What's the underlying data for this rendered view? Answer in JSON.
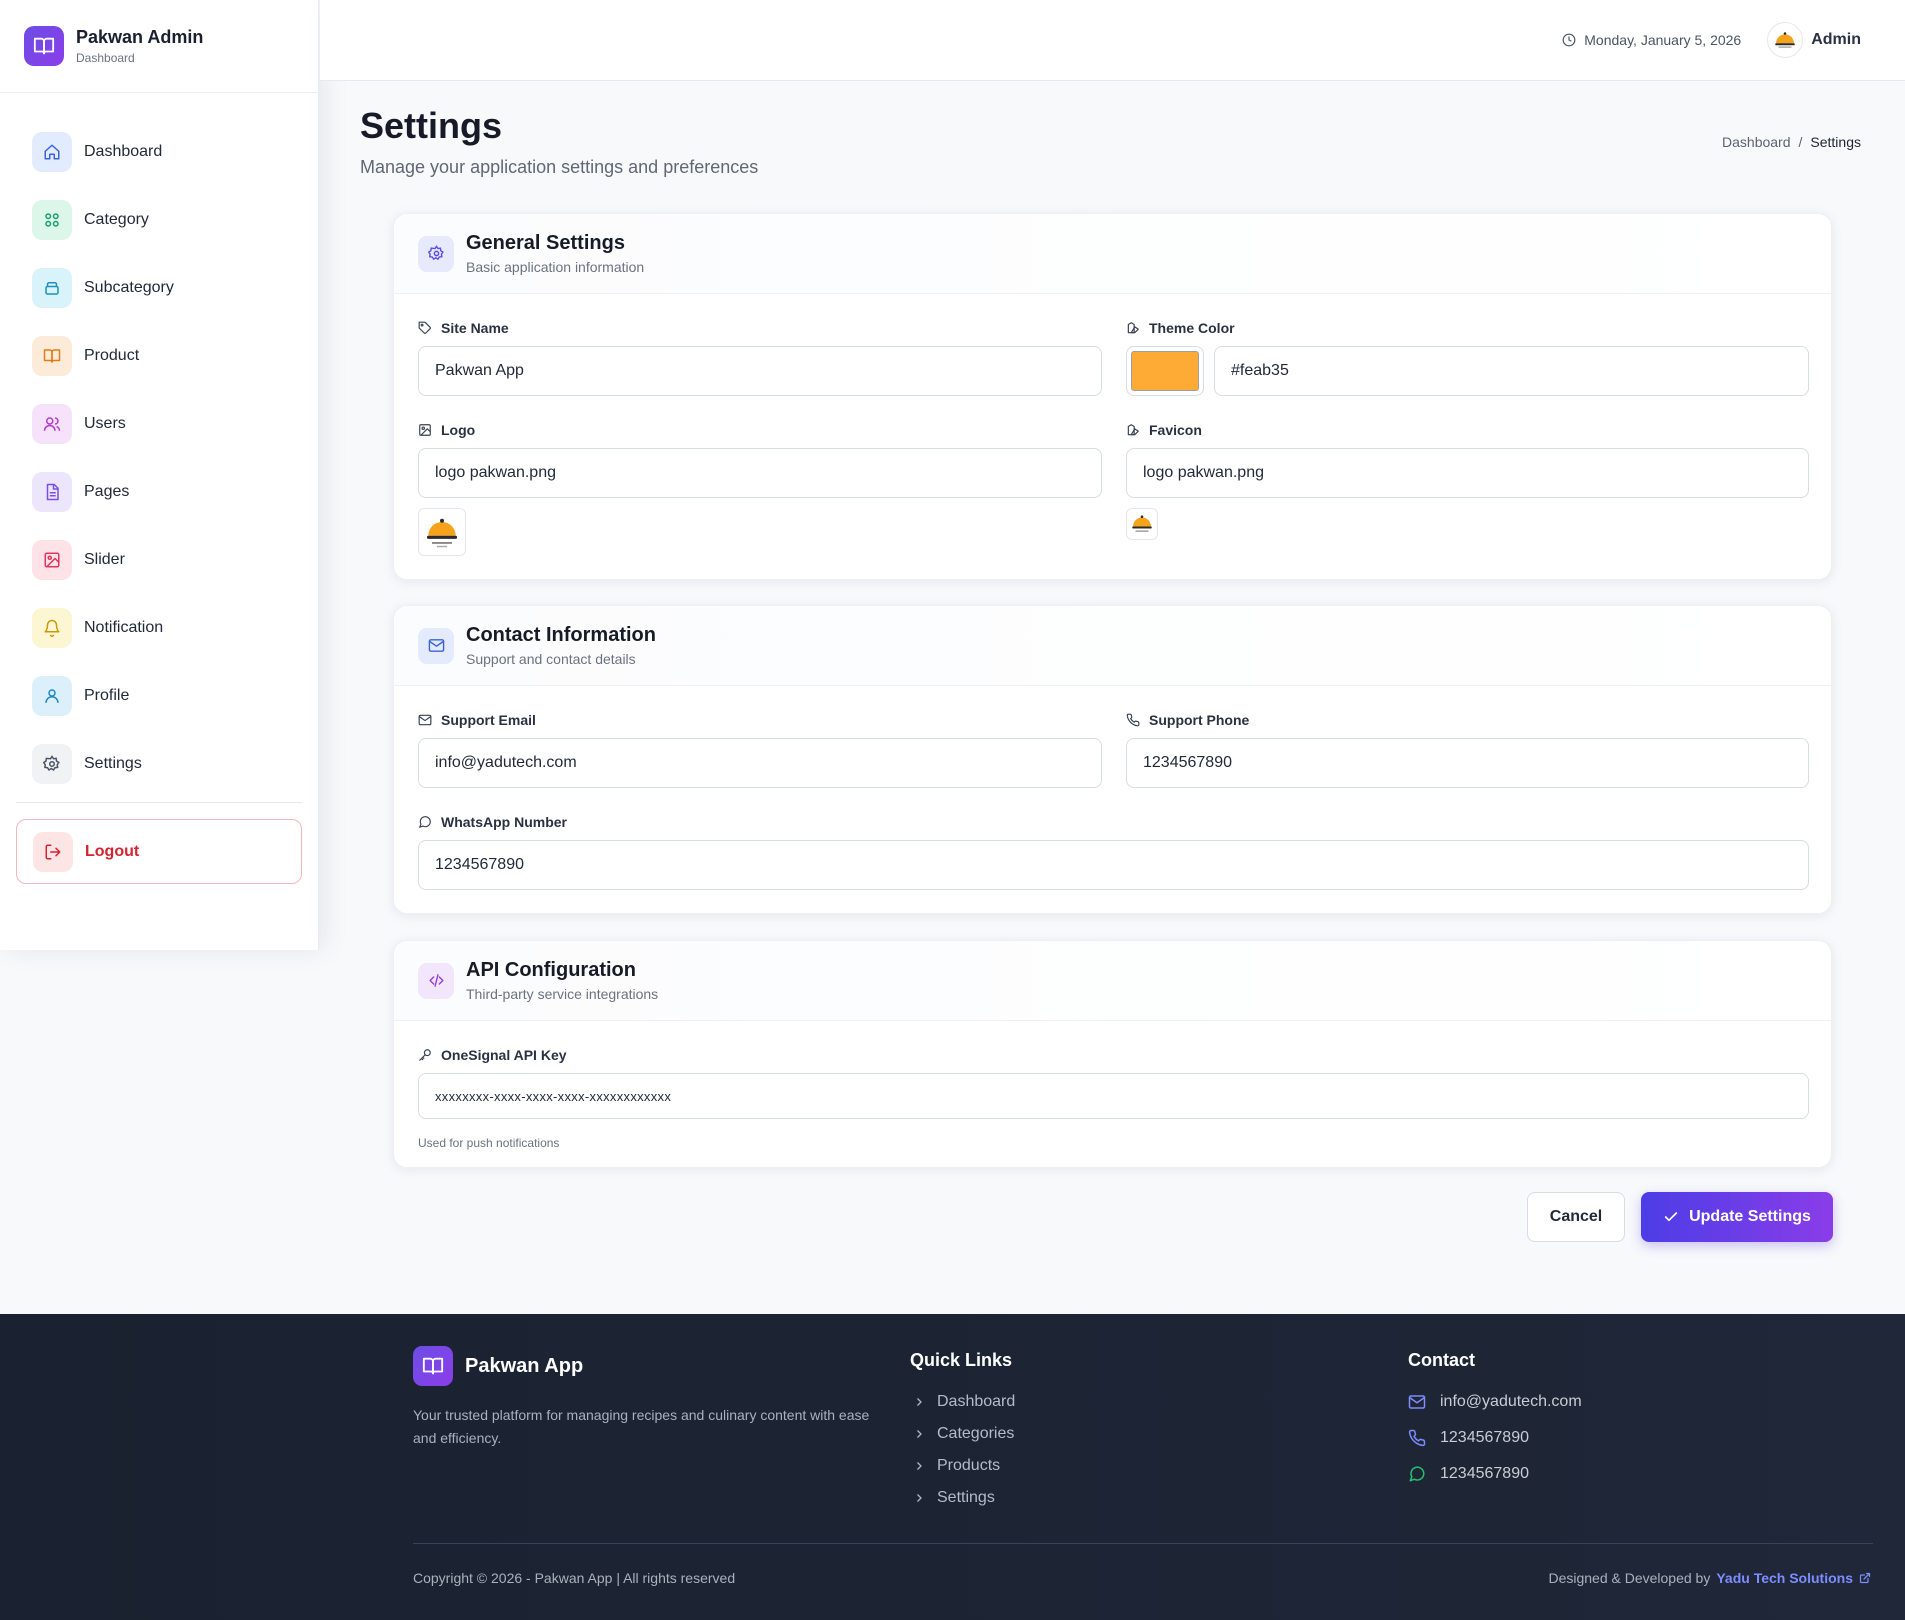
{
  "sidebar": {
    "brand_title": "Pakwan Admin",
    "brand_sub": "Dashboard",
    "items": [
      {
        "label": "Dashboard",
        "icon": "home-icon",
        "bg": "#e3ebff",
        "color": "#3b63d8"
      },
      {
        "label": "Category",
        "icon": "grid-icon",
        "bg": "#dcf6ea",
        "color": "#17a36b"
      },
      {
        "label": "Subcategory",
        "icon": "layers-icon",
        "bg": "#d9f3fb",
        "color": "#1a93b8"
      },
      {
        "label": "Product",
        "icon": "book-icon",
        "bg": "#fdebd9",
        "color": "#e07a1b"
      },
      {
        "label": "Users",
        "icon": "users-icon",
        "bg": "#f6e3fb",
        "color": "#b43ad1"
      },
      {
        "label": "Pages",
        "icon": "file-icon",
        "bg": "#ece6fd",
        "color": "#7a4ee2"
      },
      {
        "label": "Slider",
        "icon": "image-icon",
        "bg": "#fde3e8",
        "color": "#e0365a"
      },
      {
        "label": "Notification",
        "icon": "bell-icon",
        "bg": "#fdf6d2",
        "color": "#c79a0b"
      },
      {
        "label": "Profile",
        "icon": "user-icon",
        "bg": "#dcf0fb",
        "color": "#1c88c4"
      },
      {
        "label": "Settings",
        "icon": "gear-icon",
        "bg": "#f1f2f4",
        "color": "#4b5563"
      }
    ],
    "logout_label": "Logout"
  },
  "topbar": {
    "date": "Monday, January 5, 2026",
    "admin_name": "Admin"
  },
  "page": {
    "title": "Settings",
    "subtitle": "Manage your application settings and preferences",
    "breadcrumb": [
      "Dashboard",
      "/",
      "Settings"
    ]
  },
  "general": {
    "title": "General Settings",
    "subtitle": "Basic application information",
    "site_name_label": "Site Name",
    "site_name_value": "Pakwan App",
    "theme_color_label": "Theme Color",
    "theme_color_value": "#feab35",
    "logo_label": "Logo",
    "logo_value": "logo pakwan.png",
    "favicon_label": "Favicon",
    "favicon_value": "logo pakwan.png"
  },
  "contact": {
    "title": "Contact Information",
    "subtitle": "Support and contact details",
    "email_label": "Support Email",
    "email_value": "info@yadutech.com",
    "phone_label": "Support Phone",
    "phone_value": "1234567890",
    "whatsapp_label": "WhatsApp Number",
    "whatsapp_value": "1234567890"
  },
  "api": {
    "title": "API Configuration",
    "subtitle": "Third-party service integrations",
    "key_label": "OneSignal API Key",
    "key_value": "xxxxxxxx-xxxx-xxxx-xxxx-xxxxxxxxxxxx",
    "hint": "Used for push notifications"
  },
  "actions": {
    "cancel": "Cancel",
    "update": "Update Settings"
  },
  "footer": {
    "brand": "Pakwan App",
    "description": "Your trusted platform for managing recipes and culinary content with ease and efficiency.",
    "quick_links_title": "Quick Links",
    "quick_links": [
      "Dashboard",
      "Categories",
      "Products",
      "Settings"
    ],
    "contact_title": "Contact",
    "contact_email": "info@yadutech.com",
    "contact_phone": "1234567890",
    "contact_whatsapp": "1234567890",
    "copyright": "Copyright © 2026 - Pakwan App | All rights reserved",
    "credit_prefix": "Designed & Developed by",
    "credit_link": "Yadu Tech Solutions"
  },
  "colors": {
    "accent": "#5b3de6",
    "theme": "#feab35",
    "danger": "#d3242f"
  }
}
